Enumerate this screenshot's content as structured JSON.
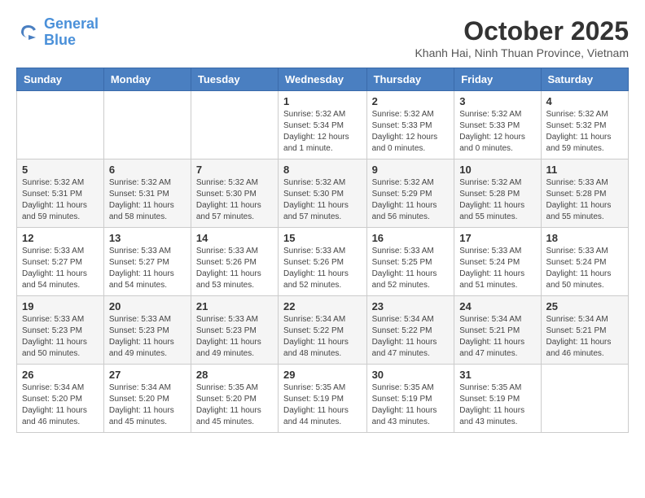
{
  "header": {
    "logo_line1": "General",
    "logo_line2": "Blue",
    "title": "October 2025",
    "subtitle": "Khanh Hai, Ninh Thuan Province, Vietnam"
  },
  "weekdays": [
    "Sunday",
    "Monday",
    "Tuesday",
    "Wednesday",
    "Thursday",
    "Friday",
    "Saturday"
  ],
  "weeks": [
    [
      {
        "day": "",
        "info": ""
      },
      {
        "day": "",
        "info": ""
      },
      {
        "day": "",
        "info": ""
      },
      {
        "day": "1",
        "info": "Sunrise: 5:32 AM\nSunset: 5:34 PM\nDaylight: 12 hours\nand 1 minute."
      },
      {
        "day": "2",
        "info": "Sunrise: 5:32 AM\nSunset: 5:33 PM\nDaylight: 12 hours\nand 0 minutes."
      },
      {
        "day": "3",
        "info": "Sunrise: 5:32 AM\nSunset: 5:33 PM\nDaylight: 12 hours\nand 0 minutes."
      },
      {
        "day": "4",
        "info": "Sunrise: 5:32 AM\nSunset: 5:32 PM\nDaylight: 11 hours\nand 59 minutes."
      }
    ],
    [
      {
        "day": "5",
        "info": "Sunrise: 5:32 AM\nSunset: 5:31 PM\nDaylight: 11 hours\nand 59 minutes."
      },
      {
        "day": "6",
        "info": "Sunrise: 5:32 AM\nSunset: 5:31 PM\nDaylight: 11 hours\nand 58 minutes."
      },
      {
        "day": "7",
        "info": "Sunrise: 5:32 AM\nSunset: 5:30 PM\nDaylight: 11 hours\nand 57 minutes."
      },
      {
        "day": "8",
        "info": "Sunrise: 5:32 AM\nSunset: 5:30 PM\nDaylight: 11 hours\nand 57 minutes."
      },
      {
        "day": "9",
        "info": "Sunrise: 5:32 AM\nSunset: 5:29 PM\nDaylight: 11 hours\nand 56 minutes."
      },
      {
        "day": "10",
        "info": "Sunrise: 5:32 AM\nSunset: 5:28 PM\nDaylight: 11 hours\nand 55 minutes."
      },
      {
        "day": "11",
        "info": "Sunrise: 5:33 AM\nSunset: 5:28 PM\nDaylight: 11 hours\nand 55 minutes."
      }
    ],
    [
      {
        "day": "12",
        "info": "Sunrise: 5:33 AM\nSunset: 5:27 PM\nDaylight: 11 hours\nand 54 minutes."
      },
      {
        "day": "13",
        "info": "Sunrise: 5:33 AM\nSunset: 5:27 PM\nDaylight: 11 hours\nand 54 minutes."
      },
      {
        "day": "14",
        "info": "Sunrise: 5:33 AM\nSunset: 5:26 PM\nDaylight: 11 hours\nand 53 minutes."
      },
      {
        "day": "15",
        "info": "Sunrise: 5:33 AM\nSunset: 5:26 PM\nDaylight: 11 hours\nand 52 minutes."
      },
      {
        "day": "16",
        "info": "Sunrise: 5:33 AM\nSunset: 5:25 PM\nDaylight: 11 hours\nand 52 minutes."
      },
      {
        "day": "17",
        "info": "Sunrise: 5:33 AM\nSunset: 5:24 PM\nDaylight: 11 hours\nand 51 minutes."
      },
      {
        "day": "18",
        "info": "Sunrise: 5:33 AM\nSunset: 5:24 PM\nDaylight: 11 hours\nand 50 minutes."
      }
    ],
    [
      {
        "day": "19",
        "info": "Sunrise: 5:33 AM\nSunset: 5:23 PM\nDaylight: 11 hours\nand 50 minutes."
      },
      {
        "day": "20",
        "info": "Sunrise: 5:33 AM\nSunset: 5:23 PM\nDaylight: 11 hours\nand 49 minutes."
      },
      {
        "day": "21",
        "info": "Sunrise: 5:33 AM\nSunset: 5:23 PM\nDaylight: 11 hours\nand 49 minutes."
      },
      {
        "day": "22",
        "info": "Sunrise: 5:34 AM\nSunset: 5:22 PM\nDaylight: 11 hours\nand 48 minutes."
      },
      {
        "day": "23",
        "info": "Sunrise: 5:34 AM\nSunset: 5:22 PM\nDaylight: 11 hours\nand 47 minutes."
      },
      {
        "day": "24",
        "info": "Sunrise: 5:34 AM\nSunset: 5:21 PM\nDaylight: 11 hours\nand 47 minutes."
      },
      {
        "day": "25",
        "info": "Sunrise: 5:34 AM\nSunset: 5:21 PM\nDaylight: 11 hours\nand 46 minutes."
      }
    ],
    [
      {
        "day": "26",
        "info": "Sunrise: 5:34 AM\nSunset: 5:20 PM\nDaylight: 11 hours\nand 46 minutes."
      },
      {
        "day": "27",
        "info": "Sunrise: 5:34 AM\nSunset: 5:20 PM\nDaylight: 11 hours\nand 45 minutes."
      },
      {
        "day": "28",
        "info": "Sunrise: 5:35 AM\nSunset: 5:20 PM\nDaylight: 11 hours\nand 45 minutes."
      },
      {
        "day": "29",
        "info": "Sunrise: 5:35 AM\nSunset: 5:19 PM\nDaylight: 11 hours\nand 44 minutes."
      },
      {
        "day": "30",
        "info": "Sunrise: 5:35 AM\nSunset: 5:19 PM\nDaylight: 11 hours\nand 43 minutes."
      },
      {
        "day": "31",
        "info": "Sunrise: 5:35 AM\nSunset: 5:19 PM\nDaylight: 11 hours\nand 43 minutes."
      },
      {
        "day": "",
        "info": ""
      }
    ]
  ]
}
